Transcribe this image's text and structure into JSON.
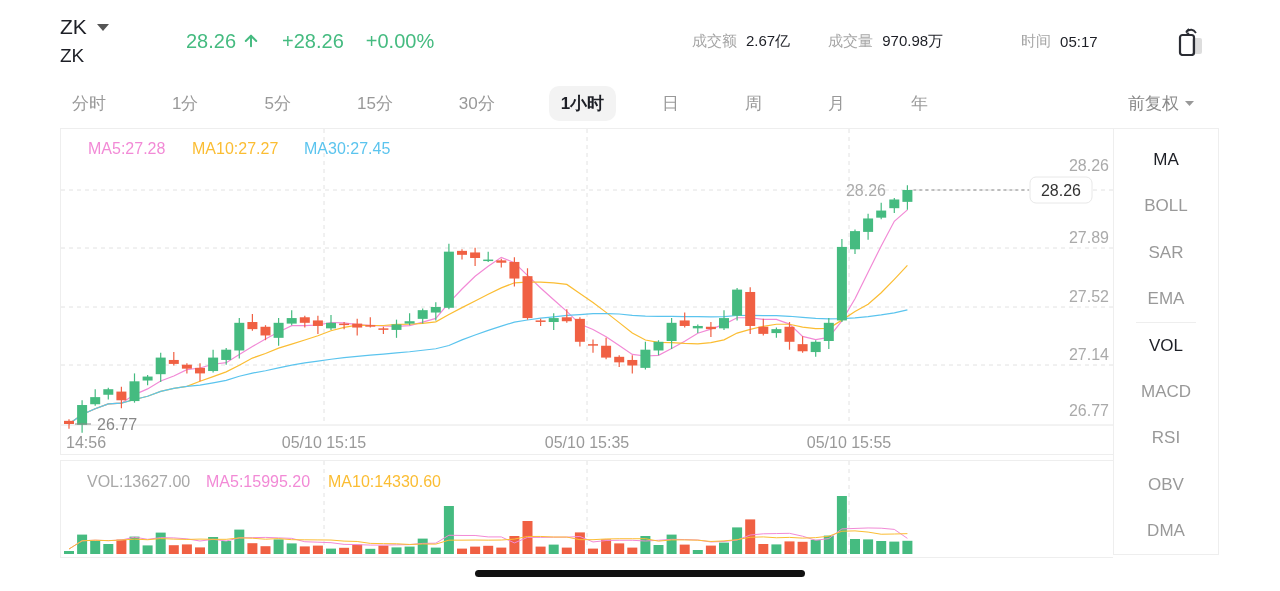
{
  "header": {
    "symbol": "ZK",
    "name": "ZK",
    "price": "28.26",
    "change": "+28.26",
    "change_pct": "+0.00%",
    "stats": [
      {
        "label": "成交额",
        "value": "2.67亿"
      },
      {
        "label": "成交量",
        "value": "970.98万"
      },
      {
        "label": "时间",
        "value": "05:17"
      }
    ]
  },
  "periods": [
    {
      "label": "分时",
      "selected": false
    },
    {
      "label": "1分",
      "selected": false
    },
    {
      "label": "5分",
      "selected": false
    },
    {
      "label": "15分",
      "selected": false
    },
    {
      "label": "30分",
      "selected": false
    },
    {
      "label": "1小时",
      "selected": true
    },
    {
      "label": "日",
      "selected": false
    },
    {
      "label": "周",
      "selected": false
    },
    {
      "label": "月",
      "selected": false
    },
    {
      "label": "年",
      "selected": false
    }
  ],
  "adjust": "前复权",
  "main_chart": {
    "legend": [
      {
        "label": "MA5:27.28",
        "color": "#f28ad6"
      },
      {
        "label": "MA10:27.27",
        "color": "#fbbd33"
      },
      {
        "label": "MA30:27.45",
        "color": "#5bc4ee"
      }
    ],
    "y_labels": [
      "28.26",
      "27.89",
      "27.52",
      "27.14",
      "26.77"
    ],
    "x_labels": [
      "14:56",
      "05/10 15:15",
      "05/10 15:35",
      "05/10 15:55"
    ],
    "last_price": "28.26",
    "high_label": "28.26",
    "low_label": "26.77"
  },
  "volume_chart": {
    "legend": [
      {
        "label": "VOL:13627.00",
        "color": "#a8a8a8"
      },
      {
        "label": "MA5:15995.20",
        "color": "#f28ad6"
      },
      {
        "label": "MA10:14330.60",
        "color": "#fbbd33"
      }
    ]
  },
  "indicators": [
    {
      "label": "MA",
      "selected": true
    },
    {
      "label": "BOLL",
      "selected": false
    },
    {
      "label": "SAR",
      "selected": false
    },
    {
      "label": "EMA",
      "selected": false
    },
    {
      "label": "VOL",
      "selected": true
    },
    {
      "label": "MACD",
      "selected": false
    },
    {
      "label": "RSI",
      "selected": false
    },
    {
      "label": "OBV",
      "selected": false
    },
    {
      "label": "DMA",
      "selected": false
    }
  ]
}
